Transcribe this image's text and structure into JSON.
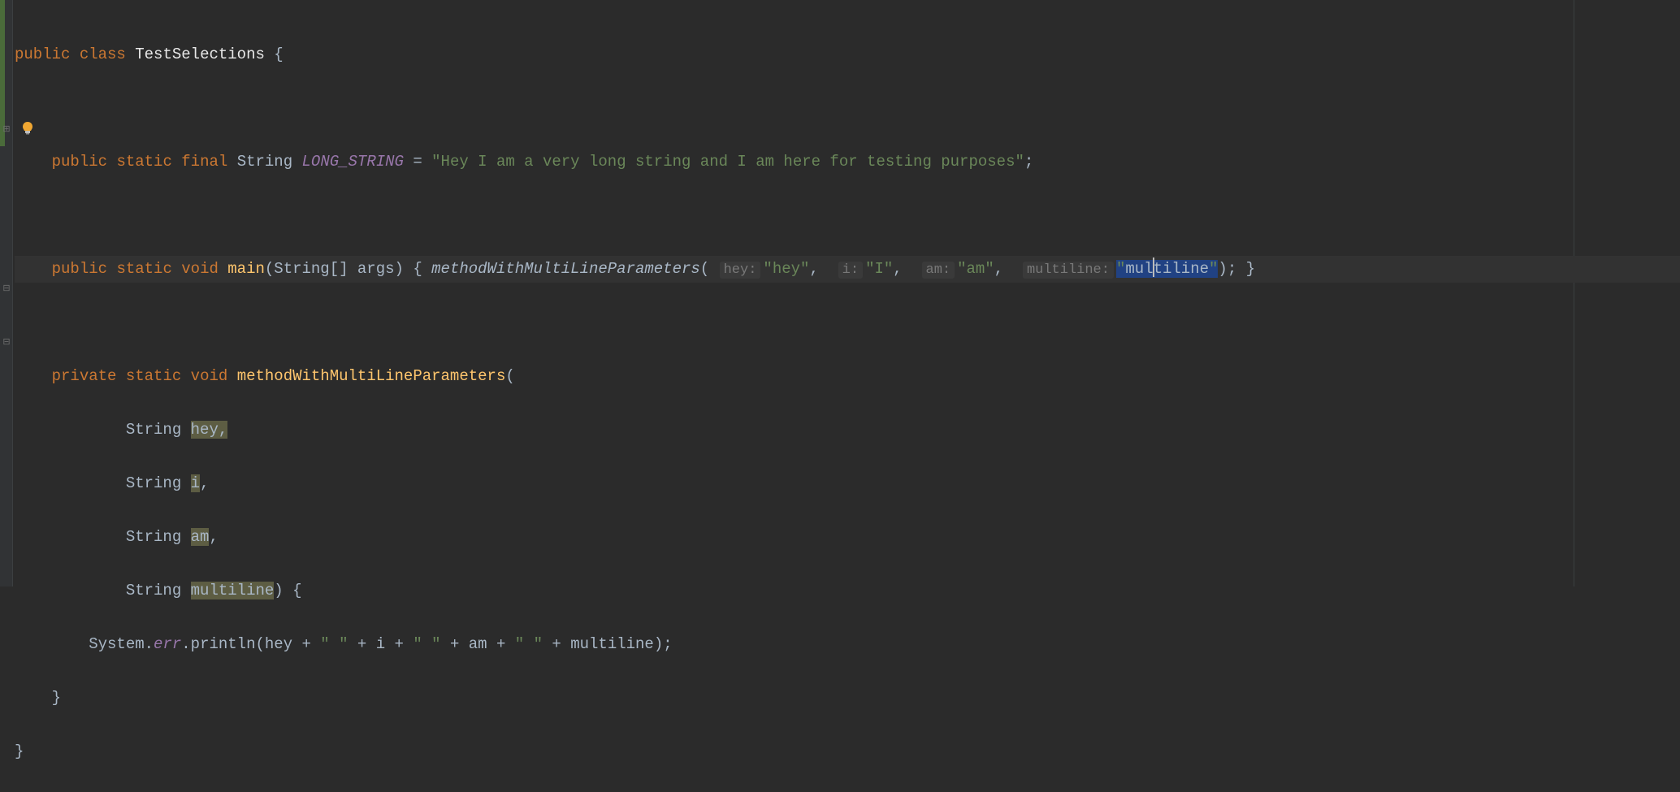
{
  "code": {
    "line1": {
      "kw_public": "public",
      "kw_class": "class",
      "classname": "TestSelections",
      "brace": " {"
    },
    "line3": {
      "indent": "    ",
      "kw_public": "public",
      "kw_static": "static",
      "kw_final": "final",
      "type": "String",
      "constant": "LONG_STRING",
      "eq": " = ",
      "string": "\"Hey I am a very long string and I am here for testing purposes\"",
      "semi": ";"
    },
    "line5": {
      "indent": "    ",
      "kw_public": "public",
      "kw_static": "static",
      "kw_void": "void",
      "method": "main",
      "params": "(String[] args)",
      "obrace": " { ",
      "call": "methodWithMultiLineParameters",
      "oparen": "(",
      "hint1_label": "hey:",
      "hint1_val": "\"hey\"",
      "c1": ", ",
      "hint2_label": "i:",
      "hint2_val": "\"I\"",
      "c2": ", ",
      "hint3_label": "am:",
      "hint3_val": "\"am\"",
      "c3": ", ",
      "hint4_label": "multiline:",
      "hint4_q1": "\"",
      "hint4_pre": "mul",
      "hint4_post": "tiline",
      "hint4_q2": "\"",
      "cparen": ")",
      "semi": ";",
      "cbrace": " }"
    },
    "line7": {
      "indent": "    ",
      "kw_private": "private",
      "kw_static": "static",
      "kw_void": "void",
      "method": "methodWithMultiLineParameters",
      "oparen": "("
    },
    "line8": {
      "indent": "            ",
      "type": "String ",
      "param": "hey",
      "comma": ","
    },
    "line9": {
      "indent": "            ",
      "type": "String ",
      "param": "i",
      "comma": ","
    },
    "line10": {
      "indent": "            ",
      "type": "String ",
      "param": "am",
      "comma": ","
    },
    "line11": {
      "indent": "            ",
      "type": "String ",
      "param": "multiline",
      "close": ") {"
    },
    "line12": {
      "indent": "        ",
      "sys": "System.",
      "err": "err",
      "println": ".println(hey + ",
      "s1": "\" \"",
      "p1": " + i + ",
      "s2": "\" \"",
      "p2": " + am + ",
      "s3": "\" \"",
      "p3": " + multiline);"
    },
    "line13": {
      "indent": "    ",
      "brace": "}"
    },
    "line14": {
      "brace": "}"
    }
  },
  "icons": {
    "bulb": "lightbulb-icon",
    "expand": "expand-fold-icon",
    "collapse": "collapse-fold-icon"
  },
  "colors": {
    "background": "#2b2b2b",
    "keyword": "#cc7832",
    "string": "#6a8759",
    "method": "#ffc66d",
    "constant": "#9876aa",
    "selection": "#214283",
    "highlight": "#bab870"
  }
}
